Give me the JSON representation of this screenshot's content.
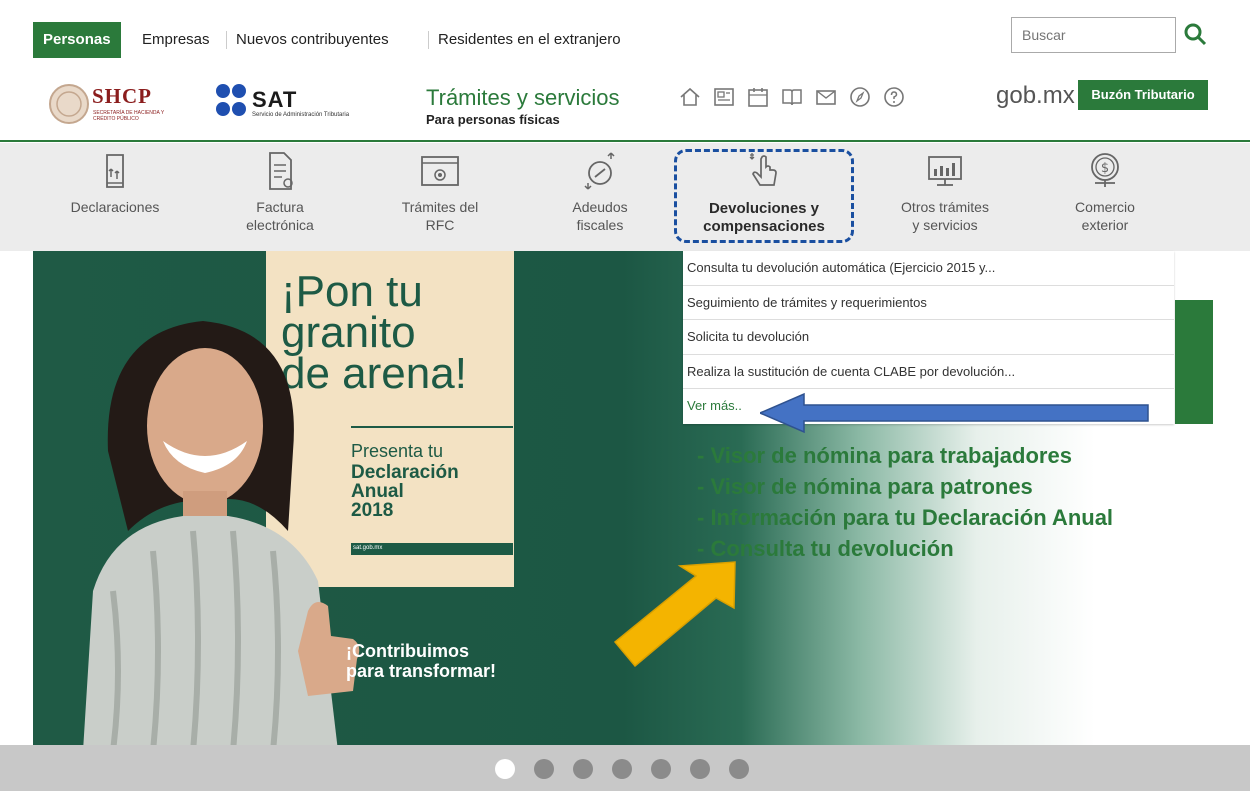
{
  "topbar": {
    "tabs": [
      {
        "label": "Personas",
        "active": true
      },
      {
        "label": "Empresas"
      },
      {
        "label": "Nuevos contribuyentes"
      },
      {
        "label": "Residentes en el extranjero"
      }
    ],
    "search_placeholder": "Buscar",
    "search_icon": "search-icon"
  },
  "header": {
    "shcp": {
      "name": "SHCP",
      "subtitle": "SECRETARÍA DE HACIENDA Y CRÉDITO PÚBLICO"
    },
    "sat": {
      "name": "SAT",
      "subtitle": "Servicio de Administración Tributaria"
    },
    "title": "Trámites y servicios",
    "subtitle": "Para personas físicas",
    "icons": [
      "home-icon",
      "news-icon",
      "calendar-icon",
      "book-icon",
      "mail-icon",
      "compass-icon",
      "help-icon"
    ],
    "gobmx": "gob.mx",
    "buzon": "Buzón Tributario"
  },
  "nav": {
    "items": [
      {
        "label": "Declaraciones",
        "icon": "declaraciones-icon"
      },
      {
        "label": "Factura\nelectrónica",
        "icon": "invoice-icon"
      },
      {
        "label": "Trámites del\nRFC",
        "icon": "rfc-icon"
      },
      {
        "label": "Adeudos\nfiscales",
        "icon": "debt-icon"
      },
      {
        "label": "Devoluciones y\ncompensaciones",
        "icon": "hand-pointer-icon",
        "active": true
      },
      {
        "label": "Otros trámites\ny servicios",
        "icon": "monitor-chart-icon"
      },
      {
        "label": "Comercio\nexterior",
        "icon": "globe-dollar-icon"
      }
    ]
  },
  "dropdown": {
    "items": [
      "Consulta tu devolución automática (Ejercicio 2015 y...",
      "Seguimiento de trámites y requerimientos",
      "Solicita tu devolución",
      "Realiza la sustitución de cuenta CLABE por devolución...",
      "Ver más.."
    ]
  },
  "hero": {
    "poster_title": "¡Pon tu\ngranito\nde arena!",
    "poster_presenta": "Presenta tu",
    "poster_declaracion": "Declaración\nAnual\n2018",
    "poster_url": "sat.gob.mx",
    "slogan": "¡Contribuimos\npara transformar!"
  },
  "annotation": {
    "items": [
      "- Visor de nómina para trabajadores",
      "- Visor de nómina para patrones",
      "- Información para tu Declaración Anual",
      "- Consulta tu devolución"
    ],
    "blue_arrow_color": "#4472c4",
    "yellow_arrow_color": "#f4b400"
  },
  "carousel": {
    "dots": 7,
    "active_index": 0
  },
  "colors": {
    "brand_green": "#2b7a3b",
    "hero_green": "#1f5a45",
    "shcp_red": "#8b1d1d"
  }
}
